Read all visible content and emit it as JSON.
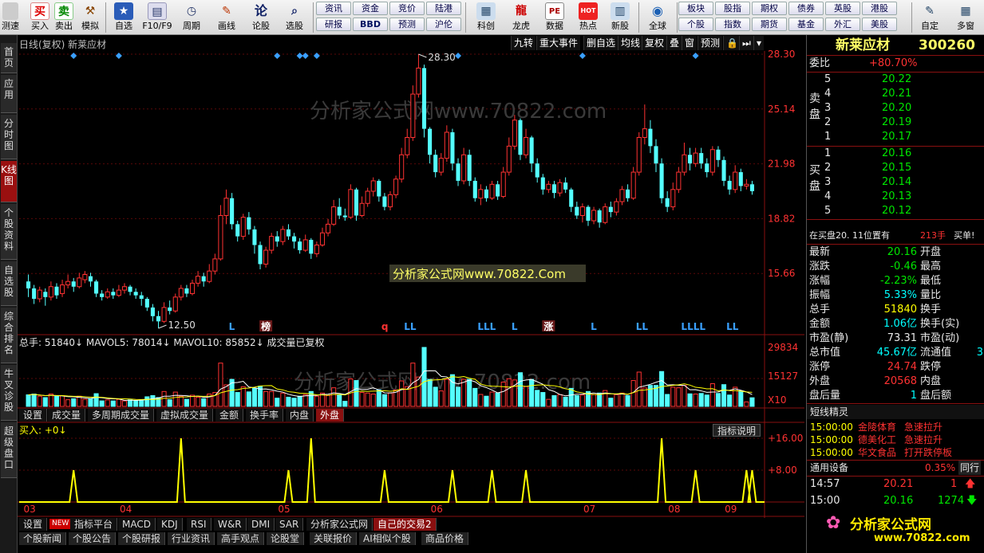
{
  "toolbar": {
    "left_buttons": [
      {
        "label": "测速",
        "icon": "speed-icon"
      },
      {
        "label": "买入",
        "icon": "buy-icon",
        "glyph": "买"
      },
      {
        "label": "卖出",
        "icon": "sell-icon",
        "glyph": "卖"
      },
      {
        "label": "模拟",
        "icon": "hammer-icon"
      },
      {
        "label": "自选",
        "icon": "star-icon"
      },
      {
        "label": "F10/F9",
        "icon": "f10-icon"
      },
      {
        "label": "周期",
        "icon": "clock-icon"
      },
      {
        "label": "画线",
        "icon": "pen-icon"
      },
      {
        "label": "论股",
        "icon": "forum-icon"
      },
      {
        "label": "选股",
        "icon": "select-stock-icon"
      }
    ],
    "pills_row1": [
      "资讯",
      "资金",
      "竞价",
      "陆港"
    ],
    "pills_row2": [
      "研报",
      "BBD",
      "预测",
      "沪伦"
    ],
    "mid_buttons": [
      {
        "label": "科创",
        "icon": "kechuang-icon"
      },
      {
        "label": "龙虎",
        "icon": "dragon-tiger-icon"
      },
      {
        "label": "数据",
        "icon": "data-icon",
        "glyph": "PE"
      },
      {
        "label": "热点",
        "icon": "hot-icon",
        "glyph": "HOT"
      },
      {
        "label": "新股",
        "icon": "new-stock-icon"
      },
      {
        "label": "全球",
        "icon": "globe-icon"
      }
    ],
    "right_pills_row1": [
      "板块",
      "股指",
      "期权",
      "债券",
      "英股",
      "港股"
    ],
    "right_pills_row2": [
      "个股",
      "指数",
      "期货",
      "基金",
      "外汇",
      "美股"
    ],
    "end_buttons": [
      {
        "label": "自定",
        "icon": "custom-icon"
      },
      {
        "label": "多窗",
        "icon": "multi-window-icon"
      }
    ]
  },
  "left_tabs": [
    {
      "label": "首页",
      "active": false
    },
    {
      "label": "应用",
      "active": false
    },
    {
      "label": "分时图",
      "active": false
    },
    {
      "label": "K线图",
      "active": true
    },
    {
      "label": "个股资料",
      "active": false
    },
    {
      "label": "自选股",
      "active": false
    },
    {
      "label": "综合排名",
      "active": false
    },
    {
      "label": "牛叉诊股",
      "active": false
    },
    {
      "label": "超级盘口",
      "active": false
    }
  ],
  "chart_header": {
    "title": "日线(复权)  新莱应材",
    "menu": [
      "九转",
      "重大事件",
      "删自选",
      "均线",
      "复权",
      "叠",
      "窗",
      "预测",
      "🔒",
      "⏭",
      "▾"
    ]
  },
  "watermark": {
    "text": "分析家公式网www.70822.com",
    "banner": "分析家公式网www.70822.Com",
    "logo_text": "分析家公式网",
    "logo_url": "www.70822.com"
  },
  "chart_data": [
    {
      "type": "candlestick",
      "price_axis": [
        "28.30",
        "25.14",
        "21.98",
        "18.82",
        "15.66"
      ],
      "ylim": [
        12.5,
        28.3
      ],
      "high_label": "28.30",
      "low_label": "12.50",
      "markers": [
        "L",
        "榜",
        "q",
        "LL",
        "LLL",
        "L",
        "涨",
        "L",
        "LL",
        "LLLL",
        "LL"
      ],
      "candles": [
        [
          15.2,
          14.8,
          15.6,
          14.3
        ],
        [
          14.8,
          14.2,
          15.0,
          13.9
        ],
        [
          14.2,
          14.7,
          14.9,
          14.0
        ],
        [
          14.6,
          14.3,
          14.8,
          13.8
        ],
        [
          14.3,
          14.9,
          15.2,
          14.1
        ],
        [
          14.9,
          14.4,
          15.1,
          14.2
        ],
        [
          14.5,
          15.0,
          15.3,
          14.3
        ],
        [
          15.0,
          15.2,
          15.6,
          14.8
        ],
        [
          15.2,
          14.9,
          15.4,
          14.6
        ],
        [
          14.9,
          15.4,
          15.7,
          14.8
        ],
        [
          15.3,
          15.6,
          15.8,
          15.1
        ],
        [
          15.5,
          15.2,
          15.7,
          14.9
        ],
        [
          15.2,
          14.5,
          15.3,
          14.3
        ],
        [
          14.5,
          14.3,
          14.7,
          14.1
        ],
        [
          14.3,
          14.6,
          14.8,
          14.2
        ],
        [
          14.6,
          14.4,
          14.8,
          14.2
        ],
        [
          14.4,
          14.7,
          15.0,
          14.3
        ],
        [
          14.7,
          14.9,
          15.1,
          14.5
        ],
        [
          14.9,
          14.6,
          15.0,
          14.4
        ],
        [
          14.6,
          14.4,
          14.8,
          14.2
        ],
        [
          14.4,
          14.2,
          14.6,
          13.8
        ],
        [
          14.2,
          13.7,
          14.3,
          13.5
        ],
        [
          13.7,
          13.2,
          13.9,
          12.9
        ],
        [
          13.2,
          12.9,
          13.5,
          12.5
        ],
        [
          12.9,
          13.7,
          14.0,
          12.8
        ],
        [
          13.7,
          13.5,
          14.1,
          13.3
        ],
        [
          13.5,
          14.3,
          14.5,
          13.4
        ],
        [
          14.3,
          14.8,
          15.0,
          14.1
        ],
        [
          14.8,
          14.5,
          15.0,
          14.3
        ],
        [
          14.5,
          15.1,
          15.3,
          14.4
        ],
        [
          15.1,
          15.5,
          15.8,
          14.9
        ],
        [
          15.5,
          15.2,
          15.7,
          14.9
        ],
        [
          15.2,
          15.8,
          16.2,
          15.1
        ],
        [
          15.8,
          16.5,
          16.8,
          15.6
        ],
        [
          16.5,
          19.0,
          19.6,
          16.4
        ],
        [
          19.0,
          20.0,
          20.5,
          18.5
        ],
        [
          20.0,
          18.5,
          20.3,
          18.2
        ],
        [
          18.5,
          17.8,
          18.7,
          17.5
        ],
        [
          17.8,
          18.9,
          19.1,
          17.6
        ],
        [
          18.9,
          18.2,
          19.2,
          17.9
        ],
        [
          18.2,
          17.3,
          18.4,
          16.8
        ],
        [
          17.3,
          16.2,
          17.5,
          15.9
        ],
        [
          16.2,
          17.0,
          17.2,
          16.0
        ],
        [
          17.0,
          17.8,
          18.0,
          16.8
        ],
        [
          17.8,
          17.5,
          18.1,
          17.2
        ],
        [
          17.5,
          18.2,
          18.4,
          17.3
        ],
        [
          18.2,
          17.8,
          18.5,
          17.6
        ],
        [
          17.8,
          17.5,
          18.0,
          17.1
        ],
        [
          17.5,
          17.0,
          17.7,
          16.8
        ],
        [
          17.0,
          17.6,
          17.9,
          16.9
        ],
        [
          17.6,
          16.8,
          17.7,
          16.5
        ],
        [
          16.8,
          17.3,
          17.5,
          16.6
        ],
        [
          17.3,
          18.0,
          18.3,
          17.2
        ],
        [
          18.0,
          18.5,
          18.8,
          17.8
        ],
        [
          18.5,
          19.5,
          19.9,
          18.4
        ],
        [
          19.5,
          19.0,
          20.0,
          18.8
        ],
        [
          19.0,
          18.9,
          19.4,
          18.7
        ],
        [
          18.9,
          20.5,
          20.8,
          18.8
        ],
        [
          20.5,
          19.0,
          20.6,
          18.7
        ],
        [
          19.0,
          19.7,
          20.1,
          18.9
        ],
        [
          19.7,
          20.4,
          20.6,
          19.5
        ],
        [
          20.4,
          21.0,
          21.2,
          20.1
        ],
        [
          21.0,
          20.1,
          21.1,
          19.8
        ],
        [
          20.1,
          19.5,
          20.3,
          19.3
        ],
        [
          19.5,
          20.2,
          20.4,
          19.3
        ],
        [
          20.2,
          21.1,
          21.3,
          20.0
        ],
        [
          21.1,
          22.5,
          22.9,
          20.9
        ],
        [
          22.5,
          23.5,
          24.0,
          22.3
        ],
        [
          23.5,
          26.0,
          26.5,
          23.3
        ],
        [
          26.0,
          27.5,
          28.3,
          25.8
        ],
        [
          27.5,
          24.0,
          27.7,
          23.5
        ],
        [
          24.0,
          22.5,
          24.1,
          22.0
        ],
        [
          22.5,
          21.5,
          22.8,
          21.2
        ],
        [
          21.5,
          22.3,
          22.6,
          21.3
        ],
        [
          22.3,
          23.8,
          24.2,
          22.1
        ],
        [
          23.8,
          22.0,
          24.0,
          21.6
        ],
        [
          22.0,
          21.0,
          22.3,
          20.7
        ],
        [
          21.0,
          22.5,
          22.9,
          20.8
        ],
        [
          22.5,
          21.0,
          22.8,
          20.7
        ],
        [
          21.0,
          20.0,
          21.2,
          19.8
        ],
        [
          20.0,
          20.5,
          20.8,
          19.6
        ],
        [
          20.5,
          20.0,
          20.7,
          19.8
        ],
        [
          20.0,
          20.8,
          21.0,
          19.9
        ],
        [
          20.8,
          20.1,
          21.0,
          19.9
        ],
        [
          20.1,
          21.5,
          21.8,
          20.0
        ],
        [
          21.5,
          23.0,
          23.5,
          21.3
        ],
        [
          23.0,
          24.5,
          24.8,
          22.8
        ],
        [
          24.5,
          22.5,
          24.6,
          22.2
        ],
        [
          22.5,
          23.5,
          24.0,
          22.3
        ],
        [
          23.5,
          22.0,
          23.6,
          21.5
        ],
        [
          22.0,
          21.2,
          22.3,
          20.9
        ],
        [
          21.2,
          20.5,
          21.4,
          20.2
        ],
        [
          20.5,
          20.8,
          21.0,
          20.3
        ],
        [
          20.8,
          20.3,
          21.0,
          20.0
        ],
        [
          20.3,
          20.9,
          21.1,
          20.1
        ],
        [
          20.9,
          20.5,
          21.2,
          20.3
        ],
        [
          20.5,
          19.5,
          20.6,
          19.2
        ],
        [
          19.5,
          19.0,
          19.8,
          18.8
        ],
        [
          19.0,
          19.5,
          19.7,
          18.6
        ],
        [
          19.5,
          18.7,
          19.6,
          18.4
        ],
        [
          18.7,
          19.3,
          19.5,
          18.5
        ],
        [
          19.3,
          18.6,
          19.4,
          18.3
        ],
        [
          18.6,
          19.5,
          19.7,
          18.5
        ],
        [
          19.5,
          19.2,
          19.8,
          18.9
        ],
        [
          19.2,
          19.8,
          20.0,
          19.0
        ],
        [
          19.8,
          20.5,
          20.7,
          19.6
        ],
        [
          20.5,
          20.0,
          20.8,
          19.8
        ],
        [
          20.0,
          21.5,
          21.8,
          19.9
        ],
        [
          21.5,
          23.5,
          23.8,
          21.3
        ],
        [
          23.5,
          24.0,
          25.4,
          23.1
        ],
        [
          24.0,
          23.0,
          24.5,
          22.6
        ],
        [
          23.0,
          22.0,
          23.4,
          21.5
        ],
        [
          22.0,
          20.0,
          22.3,
          19.7
        ],
        [
          20.0,
          19.5,
          20.4,
          19.2
        ],
        [
          19.5,
          20.5,
          20.9,
          19.3
        ],
        [
          20.5,
          21.5,
          21.8,
          20.3
        ],
        [
          21.5,
          22.5,
          23.2,
          21.3
        ],
        [
          22.5,
          22.0,
          22.9,
          21.6
        ],
        [
          22.0,
          22.6,
          22.9,
          21.8
        ],
        [
          22.6,
          22.0,
          22.9,
          21.7
        ],
        [
          22.0,
          21.5,
          22.3,
          21.2
        ],
        [
          21.5,
          22.8,
          23.0,
          21.3
        ],
        [
          22.8,
          22.2,
          23.0,
          21.8
        ],
        [
          22.2,
          21.0,
          22.4,
          20.7
        ],
        [
          21.0,
          20.5,
          21.3,
          20.2
        ],
        [
          20.5,
          21.5,
          21.9,
          20.3
        ],
        [
          21.5,
          20.7,
          21.7,
          20.4
        ],
        [
          20.7,
          20.8,
          21.1,
          20.5
        ],
        [
          20.8,
          20.4,
          21.0,
          20.2
        ]
      ]
    },
    {
      "type": "bar",
      "title": "总手: 51840↓ MAVOL5: 78014↓ MAVOL10: 85852↓ 成交量已复权",
      "series": [
        {
          "name": "总手",
          "values": [
            51840
          ]
        },
        {
          "name": "MAVOL5",
          "values": [
            78014
          ]
        },
        {
          "name": "MAVOL10",
          "values": [
            85852
          ]
        }
      ],
      "axis_labels": [
        "29834",
        "15127",
        "X10"
      ],
      "tabs": [
        {
          "label": "设置",
          "active": false
        },
        {
          "label": "成交量",
          "active": false
        },
        {
          "label": "多周期成交量",
          "active": false
        },
        {
          "label": "虚拟成交量",
          "active": false
        },
        {
          "label": "金额",
          "active": false
        },
        {
          "label": "换手率",
          "active": false
        },
        {
          "label": "内盘",
          "active": false
        },
        {
          "label": "外盘",
          "active": true
        }
      ]
    },
    {
      "type": "line",
      "title": "买入: +0↓",
      "button": "指标说明",
      "axis_labels": [
        "+16.00",
        "+8.00"
      ],
      "ylim": [
        0,
        16
      ],
      "peaks": [
        [
          8,
          8
        ],
        [
          27,
          16
        ],
        [
          46,
          8
        ],
        [
          50,
          16
        ],
        [
          63,
          8
        ],
        [
          75,
          8
        ],
        [
          82,
          8
        ],
        [
          88,
          8
        ],
        [
          112,
          16
        ],
        [
          118,
          8
        ],
        [
          127,
          8
        ],
        [
          132,
          8
        ]
      ],
      "x_labels": [
        "03",
        "04",
        "05",
        "06",
        "07",
        "08",
        "09"
      ]
    }
  ],
  "indicator_tabs": [
    {
      "label": "设置",
      "active": false
    },
    {
      "label": "NEW",
      "badge": true
    },
    {
      "label": "指标平台",
      "active": false
    },
    {
      "label": "MACD",
      "active": false
    },
    {
      "label": "KDJ",
      "active": false
    },
    {
      "label": "RSI",
      "active": false
    },
    {
      "label": "W&R",
      "active": false
    },
    {
      "label": "DMI",
      "active": false
    },
    {
      "label": "SAR",
      "active": false
    },
    {
      "label": "分析家公式网",
      "active": false
    },
    {
      "label": "自己的交易2",
      "active": true
    }
  ],
  "bottom_tabs": [
    "个股新闻",
    "个股公告",
    "个股研报",
    "行业资讯",
    "高手观点",
    "论股堂",
    "关联报价",
    "AI相似个股",
    "商品价格"
  ],
  "quote": {
    "name": "新莱应材",
    "code": "300260",
    "weibi_label": "委比",
    "weibi_value": "+80.70%",
    "sell_label": "卖盘",
    "buy_label": "买盘",
    "asks": [
      {
        "level": "5",
        "price": "20.22"
      },
      {
        "level": "4",
        "price": "20.21"
      },
      {
        "level": "3",
        "price": "20.20"
      },
      {
        "level": "2",
        "price": "20.19"
      },
      {
        "level": "1",
        "price": "20.17"
      }
    ],
    "bids": [
      {
        "level": "1",
        "price": "20.16"
      },
      {
        "level": "2",
        "price": "20.15"
      },
      {
        "level": "3",
        "price": "20.14"
      },
      {
        "level": "4",
        "price": "20.13"
      },
      {
        "level": "5",
        "price": "20.12"
      }
    ],
    "notice_prefix": "在买盘20. 11位置有",
    "notice_volume": "213手",
    "notice_suffix": "买单!",
    "stats": [
      {
        "l1": "最新",
        "v1": "20.16",
        "c1": "green",
        "l2": "开盘",
        "v2": ""
      },
      {
        "l1": "涨跌",
        "v1": "-0.46",
        "c1": "green",
        "l2": "最高",
        "v2": ""
      },
      {
        "l1": "涨幅",
        "v1": "-2.23%",
        "c1": "green",
        "l2": "最低",
        "v2": ""
      },
      {
        "l1": "振幅",
        "v1": "5.33%",
        "c1": "cyan",
        "l2": "量比",
        "v2": ""
      },
      {
        "l1": "总手",
        "v1": "51840",
        "c1": "yellow",
        "l2": "换手",
        "v2": ""
      },
      {
        "l1": "金额",
        "v1": "1.06亿",
        "c1": "cyan",
        "l2": "换手(实)",
        "v2": ""
      },
      {
        "l1": "市盈(静)",
        "v1": "73.31",
        "c1": "white",
        "l2": "市盈(动)",
        "v2": ""
      },
      {
        "l1": "总市值",
        "v1": "45.67亿",
        "c1": "cyan",
        "l2": "流通值",
        "v2": "3"
      },
      {
        "l1": "涨停",
        "v1": "24.74",
        "c1": "red",
        "l2": "跌停",
        "v2": ""
      },
      {
        "l1": "外盘",
        "v1": "20568",
        "c1": "red",
        "l2": "内盘",
        "v2": ""
      },
      {
        "l1": "盘后量",
        "v1": "1",
        "c1": "cyan",
        "l2": "盘后额",
        "v2": ""
      }
    ],
    "short_title": "短线精灵",
    "short_items": [
      {
        "time": "15:00:00",
        "name": "金陵体育",
        "action": "急速拉升"
      },
      {
        "time": "15:00:00",
        "name": "德美化工",
        "action": "急速拉升"
      },
      {
        "time": "15:00:00",
        "name": "华文食品",
        "action": "打开跌停板"
      }
    ],
    "industry_label": "通用设备",
    "industry_change": "0.35%",
    "industry_btn": "同行",
    "ticks": [
      {
        "time": "14:57",
        "price": "20.21",
        "vol": "1",
        "dir": "up"
      },
      {
        "time": "15:00",
        "price": "20.16",
        "vol": "1274",
        "dir": "down"
      }
    ]
  },
  "colors": {
    "up": "#ff3232",
    "down": "#54ffff",
    "grid": "#8a1010",
    "ma5": "#ffffff",
    "ma10": "#ffff00"
  }
}
